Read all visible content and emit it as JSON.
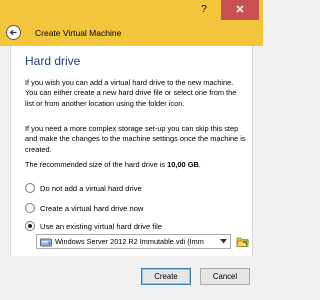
{
  "window": {
    "help_label": "?",
    "close_label": "✕",
    "title": "Create Virtual Machine"
  },
  "page": {
    "title": "Hard drive",
    "para1": "If you wish you can add a virtual hard drive to the new machine. You can either create a new hard drive file or select one from the list or from another location using the folder icon.",
    "para2": "If you need a more complex storage set-up you can skip this step and make the changes to the machine settings once the machine is created.",
    "para3_prefix": "The recommended size of the hard drive is ",
    "para3_size": "10,00 GB",
    "para3_suffix": "."
  },
  "options": [
    {
      "label": "Do not add a virtual hard drive",
      "selected": false
    },
    {
      "label": "Create a virtual hard drive now",
      "selected": false
    },
    {
      "label": "Use an existing virtual hard drive file",
      "selected": true
    }
  ],
  "disk_select": {
    "value": "Windows Server 2012 R2 Immutable.vdi (Imm"
  },
  "buttons": {
    "create": "Create",
    "cancel": "Cancel"
  },
  "colors": {
    "title_bar": "#f3c53d",
    "close_button": "#c75050",
    "page_title": "#1e3e8c"
  }
}
